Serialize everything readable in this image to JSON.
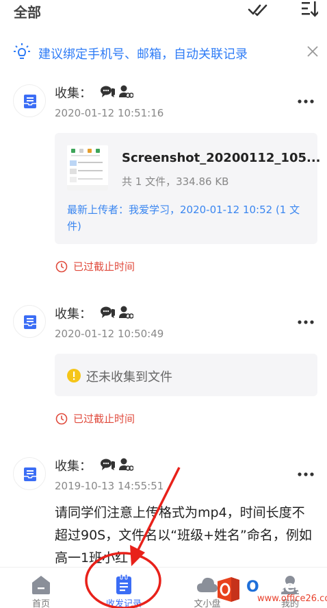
{
  "header": {
    "title": "全部",
    "mark_read_icon": "double-check-icon",
    "filter_icon": "filter-list-icon"
  },
  "banner": {
    "text": "建议绑定手机号、邮箱，自动关联记录",
    "icon": "lightbulb-icon",
    "close_icon": "close-icon"
  },
  "records": [
    {
      "label": "收集：",
      "date": "2020-01-12 10:51:16",
      "file": {
        "name": "Screenshot_20200112_105...",
        "meta": "共 1 文件，334.86 KB",
        "uploader": "最新上传者：我爱学习，2020-01-12 10:52 (1 文件)"
      },
      "deadline": "已过截止时间"
    },
    {
      "label": "收集：",
      "date": "2020-01-12 10:50:49",
      "empty_msg": "还未收集到文件",
      "deadline": "已过截止时间"
    },
    {
      "label": "收集：",
      "date": "2019-10-13 14:55:51",
      "description": "请同学们注意上传格式为mp4，时间长度不超过90S，文件名以“班级+姓名”命名，例如高一1班小红"
    }
  ],
  "bottom_nav": [
    {
      "label": "首页",
      "icon": "home-icon",
      "active": false
    },
    {
      "label": "收发记录",
      "icon": "records-icon",
      "active": true
    },
    {
      "label": "文小盘",
      "icon": "cloud-icon",
      "active": false
    },
    {
      "label": "我的",
      "icon": "profile-icon",
      "active": false
    }
  ],
  "colors": {
    "accent": "#3b6df5",
    "link": "#2f7cf6",
    "deadline": "#e04a3c",
    "annotation": "#e8211a"
  },
  "watermark": {
    "title_prefix": "O",
    "title_rest": "ffice教程网",
    "url": "www.office26.com"
  }
}
